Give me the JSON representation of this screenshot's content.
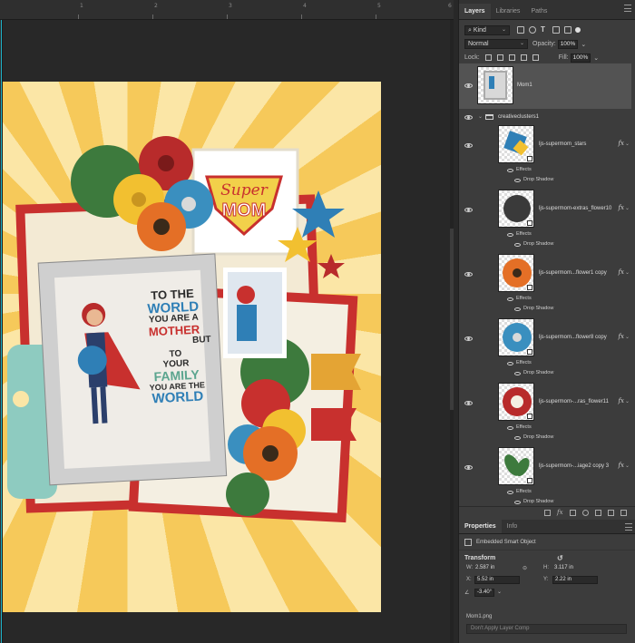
{
  "ruler": {
    "top_numbers": [
      "1",
      "2",
      "3",
      "4",
      "5",
      "6"
    ]
  },
  "panel_tabs": [
    {
      "label": "Layers",
      "active": true
    },
    {
      "label": "Libraries",
      "active": false
    },
    {
      "label": "Paths",
      "active": false
    }
  ],
  "filter": {
    "kind_label": "Kind"
  },
  "blend": {
    "mode": "Normal",
    "opacity_label": "Opacity:",
    "opacity_value": "100%"
  },
  "lock": {
    "label": "Lock:",
    "fill_label": "Fill:",
    "fill_value": "100%"
  },
  "layers": {
    "top_layer": {
      "name": "Mom1"
    },
    "group": {
      "name": "creativeclusters1"
    },
    "items": [
      {
        "name": "ljs-supermom_stars",
        "effects_label": "Effects",
        "effect": "Drop Shadow",
        "fx": "fx",
        "thumb_color": "#2f7fb6"
      },
      {
        "name": "ljs-supermom-extras_flower10",
        "effects_label": "Effects",
        "effect": "Drop Shadow",
        "fx": "fx",
        "thumb_color": "#3a3a3a"
      },
      {
        "name": "ljs-supermom...flower1 copy",
        "effects_label": "Effects",
        "effect": "Drop Shadow",
        "fx": "fx",
        "thumb_color": "#e46f26"
      },
      {
        "name": "ljs-supermom...flower8 copy",
        "effects_label": "Effects",
        "effect": "Drop Shadow",
        "fx": "fx",
        "thumb_color": "#3a8fbf"
      },
      {
        "name": "ljs-supermom-...ras_flower11",
        "effects_label": "Effects",
        "effect": "Drop Shadow",
        "fx": "fx",
        "thumb_color": "#b82b2b"
      },
      {
        "name": "ljs-supermom-...iage2 copy 3",
        "effects_label": "Effects",
        "effect": "Drop Shadow",
        "fx": "fx",
        "thumb_color": "#3d7a3d"
      }
    ]
  },
  "properties": {
    "tabs": [
      {
        "label": "Properties",
        "active": true
      },
      {
        "label": "Info",
        "active": false
      }
    ],
    "object_type": "Embedded Smart Object",
    "transform_label": "Transform",
    "w_label": "W:",
    "w_value": "2.587 in",
    "h_label": "H:",
    "h_value": "3.117 in",
    "x_label": "X:",
    "x_value": "5.52 in",
    "y_label": "Y:",
    "y_value": "2.22 in",
    "angle_value": "-3.40°",
    "file_name": "Mom1.png",
    "layer_comp": "Don't Apply Layer Comp"
  },
  "artwork": {
    "quote_lines": [
      "TO THE",
      "WORLD",
      "YOU ARE A",
      "MOTHER",
      "BUT",
      "TO",
      "YOUR",
      "FAMILY",
      "YOU ARE THE",
      "WORLD"
    ],
    "badge_top": "Super",
    "badge_bottom": "MOM"
  },
  "colors": {
    "bg_yellow": "#f6c95a",
    "red": "#c8302e",
    "teal": "#8ecbc0",
    "blue": "#2f7fb6",
    "navy": "#2b3f6b"
  }
}
